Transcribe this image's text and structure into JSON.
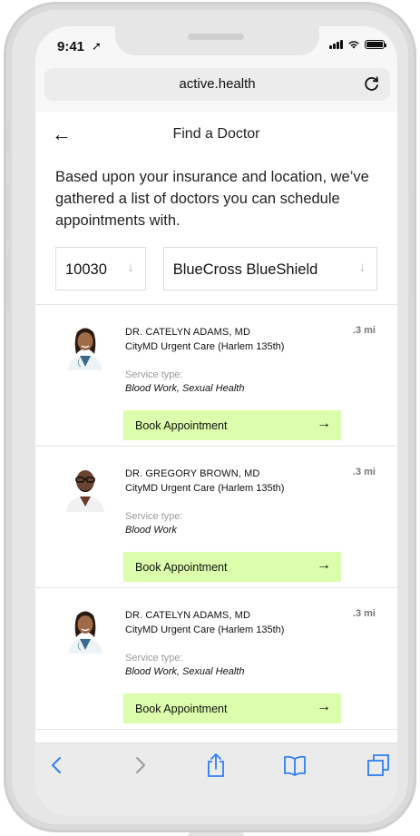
{
  "status_bar": {
    "time": "9:41"
  },
  "browser": {
    "url": "active.health"
  },
  "page": {
    "title": "Find a Doctor",
    "intro": "Based upon your insurance and location, we’ve gathered a list of doctors you can schedule appointments with."
  },
  "filters": {
    "zip": "10030",
    "insurance": "BlueCross BlueShield"
  },
  "doctors": [
    {
      "name": "DR. CATELYN ADAMS, MD",
      "clinic": "CityMD Urgent Care (Harlem 135th)",
      "distance": ".3 mi",
      "service_label": "Service type:",
      "services": "Blood Work, Sexual Health",
      "button": "Book Appointment"
    },
    {
      "name": "DR. GREGORY BROWN, MD",
      "clinic": "CityMD Urgent Care (Harlem 135th)",
      "distance": ".3 mi",
      "service_label": "Service type:",
      "services": "Blood Work",
      "button": "Book Appointment"
    },
    {
      "name": "DR. CATELYN ADAMS, MD",
      "clinic": "CityMD Urgent Care (Harlem 135th)",
      "distance": ".3 mi",
      "service_label": "Service type:",
      "services": "Blood Work, Sexual Health",
      "button": "Book Appointment"
    }
  ],
  "colors": {
    "book_button": "#dcfdab",
    "toolbar_icons": "#2f7ef6"
  }
}
